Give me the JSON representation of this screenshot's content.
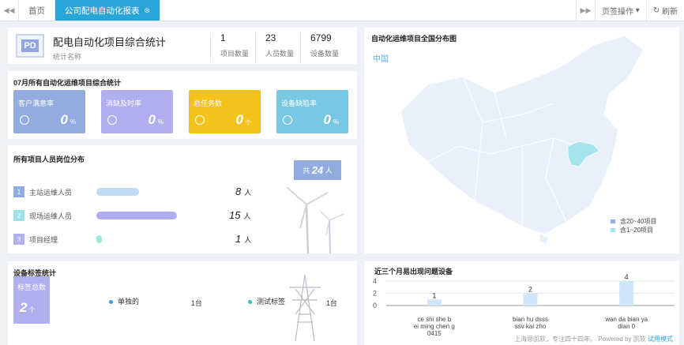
{
  "tabs": {
    "home": "首页",
    "active": "公司配电自动化报表",
    "page_ops": "页签操作",
    "refresh": "刷新"
  },
  "summary": {
    "logo": "PD",
    "title": "配电自动化项目综合统计",
    "subtitle": "统计名称",
    "stats": [
      {
        "value": "1",
        "label": "项目数量"
      },
      {
        "value": "23",
        "label": "人员数量"
      },
      {
        "value": "6799",
        "label": "设备数量"
      }
    ]
  },
  "monthly": {
    "title": "07月所有自动化运维项目综合统计",
    "cards": [
      {
        "label": "客户满意率",
        "value": "0",
        "unit": "%",
        "color": "#93acdf"
      },
      {
        "label": "消缺及时率",
        "value": "0",
        "unit": "%",
        "color": "#b1aef0"
      },
      {
        "label": "总任务数",
        "value": "0",
        "unit": "个",
        "color": "#f3c21b"
      },
      {
        "label": "设备缺陷率",
        "value": "0",
        "unit": "%",
        "color": "#78c8e4"
      }
    ]
  },
  "personnel": {
    "title": "所有项目人员岗位分布",
    "total_prefix": "共",
    "total": "24",
    "total_unit": "人",
    "unit": "人",
    "max": 15,
    "rows": [
      {
        "num": "1",
        "name": "主站运维人员",
        "count": 8,
        "color": "#bfdcf7",
        "numColor": "#93acdf"
      },
      {
        "num": "2",
        "name": "现场运维人员",
        "count": 15,
        "color": "#b1aef0",
        "numColor": "#9fe0e8"
      },
      {
        "num": "3",
        "name": "项目经理",
        "count": 1,
        "color": "#9fe8e0",
        "numColor": "#b1aef0"
      }
    ]
  },
  "devices": {
    "title": "设备标签统计",
    "box_label": "标签总数",
    "box_value": "2",
    "box_unit": "个",
    "items": [
      {
        "name": "单独的",
        "count": "1台",
        "color": "#3b9ee5"
      },
      {
        "name": "测试标签",
        "count": "1台",
        "color": "#2fc5b8"
      }
    ]
  },
  "map": {
    "title": "自动化运维项目全国分布图",
    "label": "中国",
    "legend": [
      {
        "text": "含20~40项目",
        "color": "#93acdf"
      },
      {
        "text": "含1~20项目",
        "color": "#a6e4ee"
      }
    ]
  },
  "chart_data": {
    "type": "bar",
    "title": "近三个月易出现问题设备",
    "categories": [
      "ce shi she b ei ming chen g 0415",
      "bian hu dsss ssv kai zho",
      "wan da bian ya dian 0"
    ],
    "values": [
      1,
      2,
      4
    ],
    "ylim": [
      0,
      4
    ],
    "yticks": [
      0,
      2,
      4
    ],
    "grid": true,
    "color": "#cfe6fb"
  },
  "footer": {
    "text": "上海思凯软，专注四十四年。 Powered by 凯软",
    "mode": "试用模式"
  }
}
